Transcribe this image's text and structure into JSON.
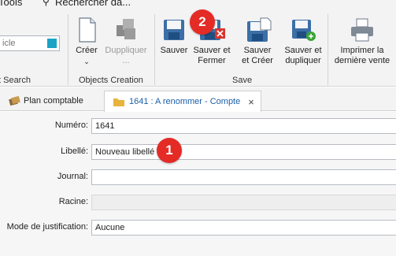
{
  "menu": {
    "tools_label": "Tools",
    "search_label": "Rechercher da..."
  },
  "ribbon": {
    "search_group": {
      "placeholder": "icle",
      "label": "t Search"
    },
    "objects_group": {
      "label": "Objects Creation",
      "create": {
        "line1": "Créer",
        "line2": ""
      },
      "duplicate": {
        "line1": "Duppliquer",
        "line2": "..."
      }
    },
    "save_group": {
      "label": "Save",
      "save": {
        "line1": "Sauver",
        "line2": ""
      },
      "save_close": {
        "line1": "Sauver et",
        "line2": "Fermer"
      },
      "save_create": {
        "line1": "Sauver",
        "line2": "et Créer"
      },
      "save_duplicate": {
        "line1": "Sauver et",
        "line2": "dupliquer"
      }
    },
    "print_group": {
      "print_last_sale": {
        "line1": "Imprimer la",
        "line2": "dernière vente"
      }
    }
  },
  "tabs": [
    {
      "label": "Plan comptable",
      "active": false
    },
    {
      "label": "1641 : A renommer - Compte",
      "active": true,
      "close": "×"
    }
  ],
  "form": {
    "numero": {
      "label": "Numéro:",
      "value": "1641"
    },
    "libelle": {
      "label": "Libellé:",
      "value": "Nouveau libellé"
    },
    "journal": {
      "label": "Journal:",
      "value": ""
    },
    "racine": {
      "label": "Racine:",
      "value": ""
    },
    "mode_justification": {
      "label": "Mode de justification:",
      "value": "Aucune"
    }
  },
  "annotations": [
    {
      "number": "1"
    },
    {
      "number": "2"
    }
  ],
  "colors": {
    "badge": "#e42b26",
    "folder": "#e8b43c",
    "search_swatch": "#1aa3c4",
    "active_tab_text": "#1c5fa8"
  }
}
